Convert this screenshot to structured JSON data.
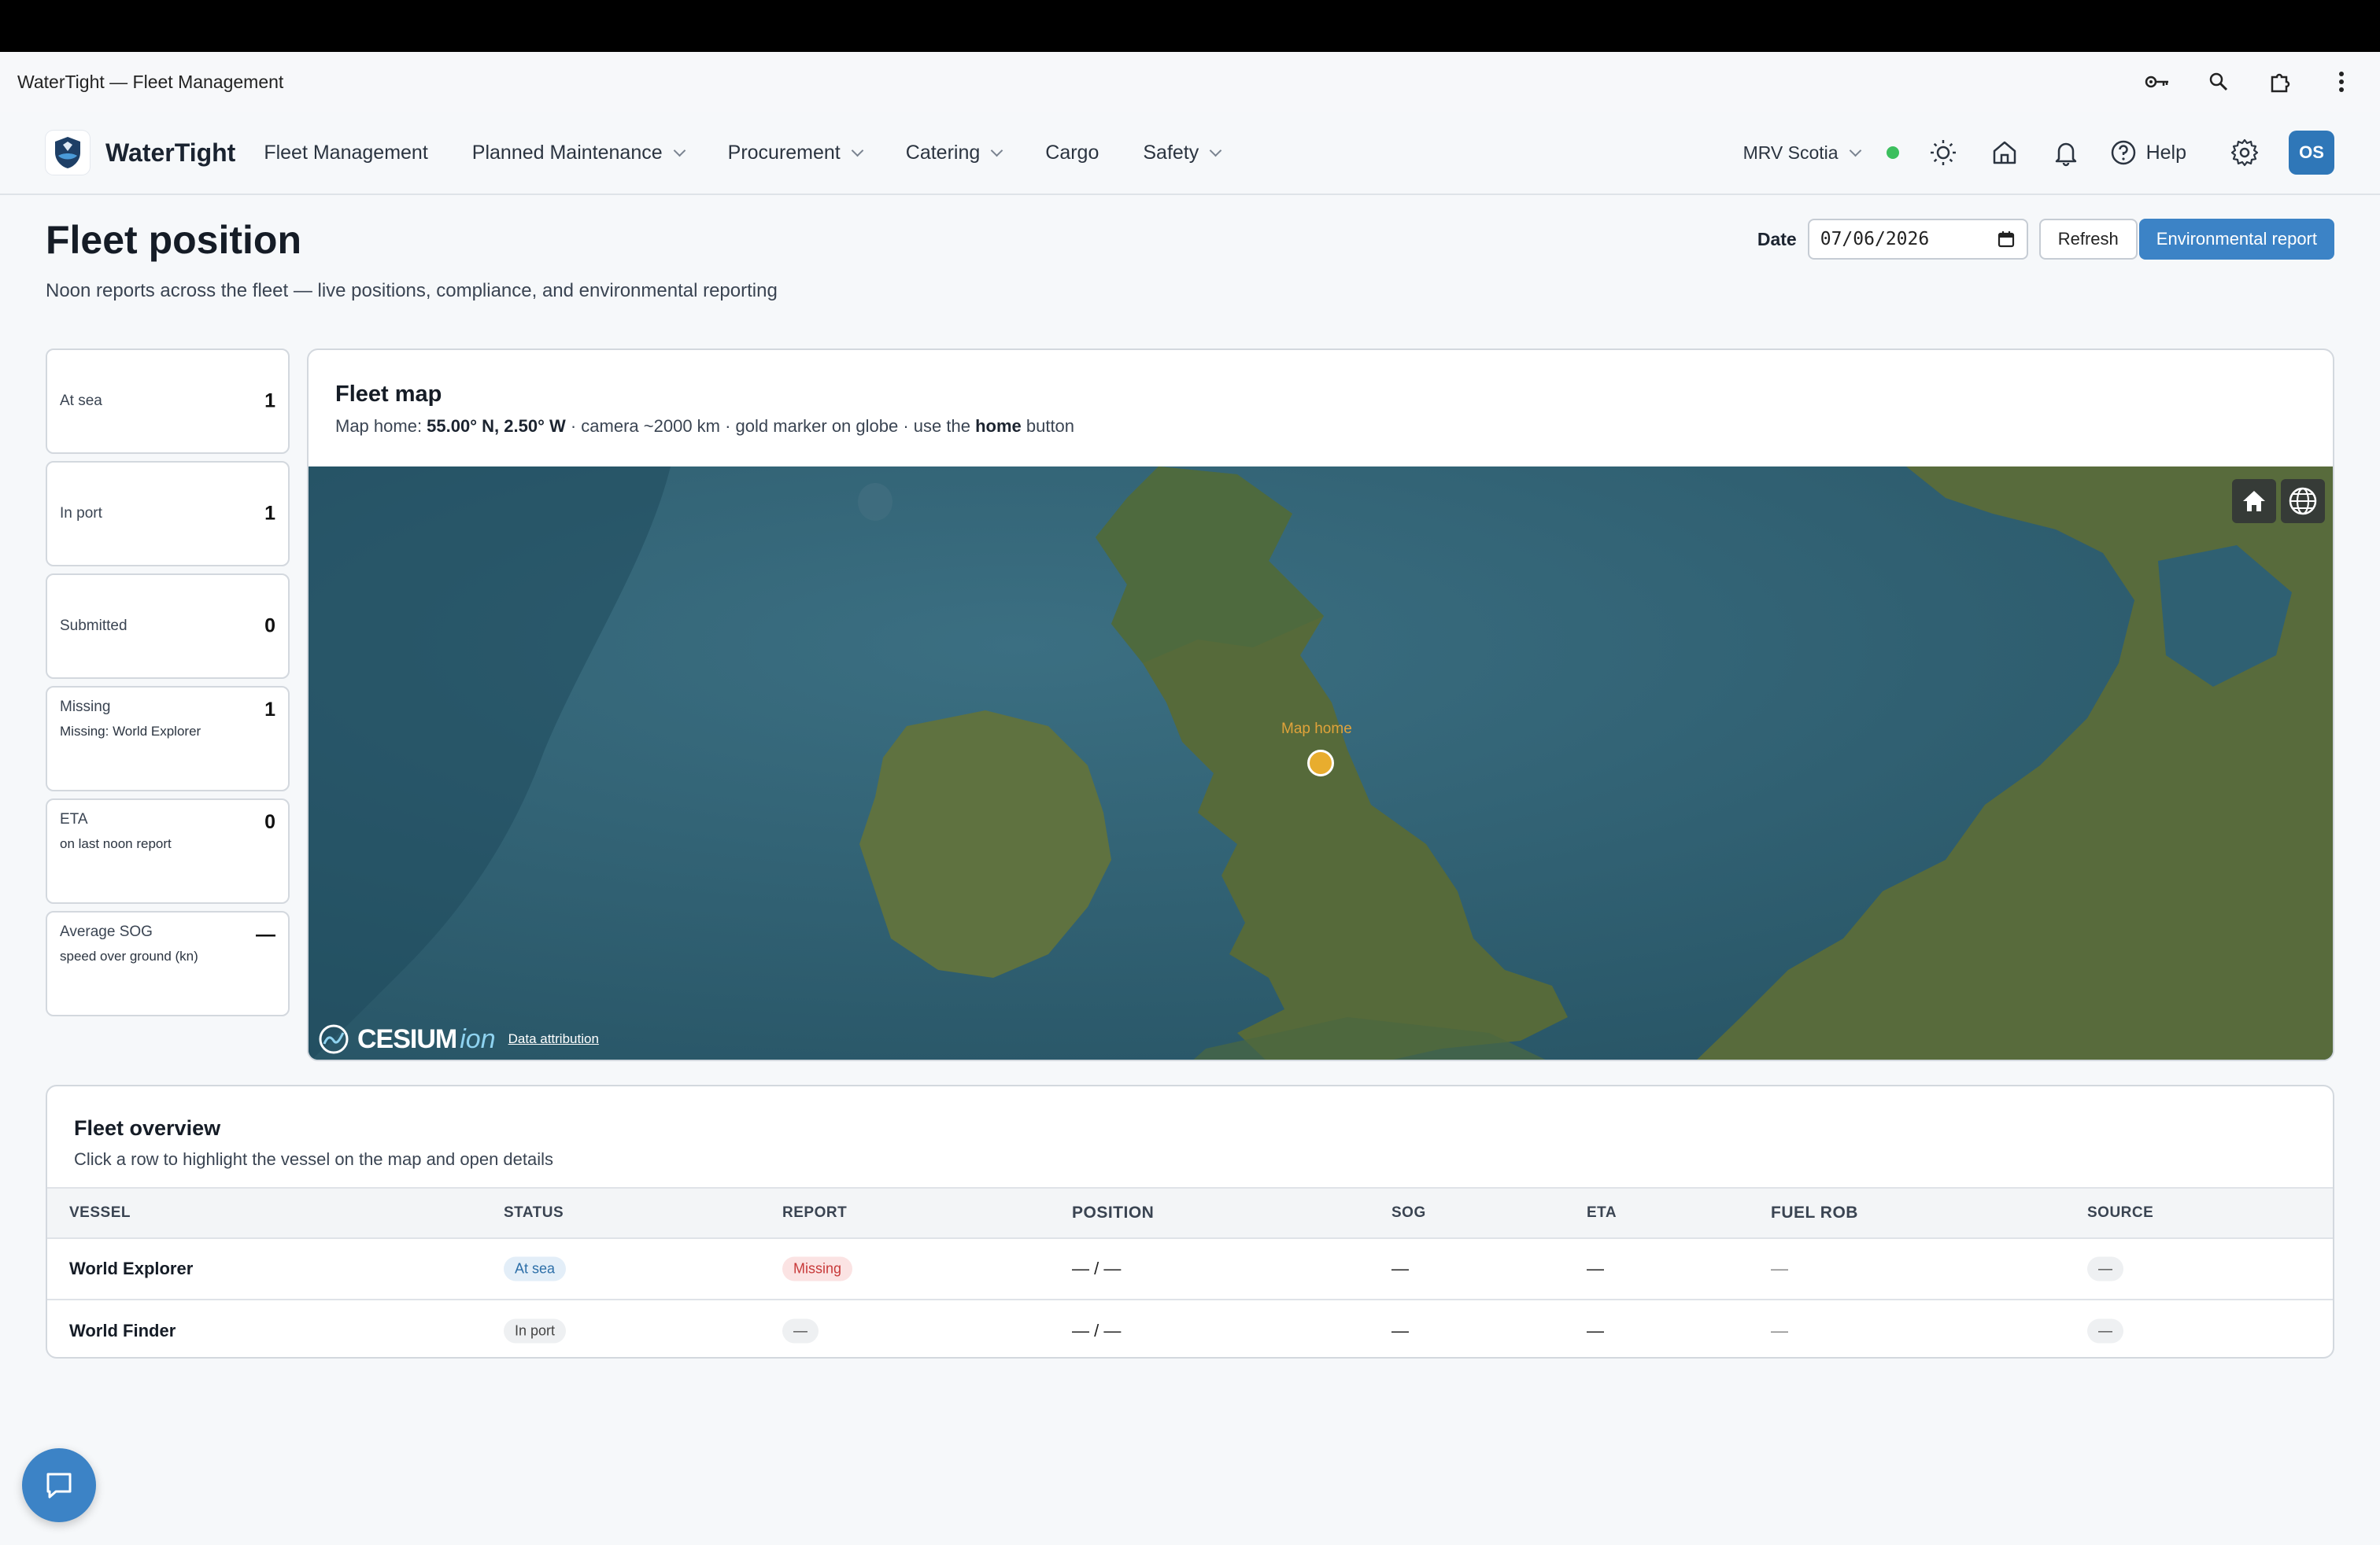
{
  "window": {
    "title": "WaterTight — Fleet Management"
  },
  "app": {
    "brand": "WaterTight",
    "nav": [
      {
        "label": "Fleet Management",
        "dropdown": false
      },
      {
        "label": "Planned Maintenance",
        "dropdown": true
      },
      {
        "label": "Procurement",
        "dropdown": true
      },
      {
        "label": "Catering",
        "dropdown": true
      },
      {
        "label": "Cargo",
        "dropdown": false
      },
      {
        "label": "Safety",
        "dropdown": true
      }
    ],
    "vessel_selector": "MRV Scotia",
    "help_label": "Help",
    "avatar_initials": "OS"
  },
  "page": {
    "title": "Fleet position",
    "subtitle": "Noon reports across the fleet — live positions, compliance, and environmental reporting",
    "date_label": "Date",
    "date_value": "07/06/2026",
    "refresh_label": "Refresh",
    "env_report_label": "Environmental report"
  },
  "stats": [
    {
      "label": "At sea",
      "value": "1",
      "sub": ""
    },
    {
      "label": "In port",
      "value": "1",
      "sub": ""
    },
    {
      "label": "Submitted",
      "value": "0",
      "sub": ""
    },
    {
      "label": "Missing",
      "value": "1",
      "sub": "Missing: World Explorer"
    },
    {
      "label": "ETA",
      "value": "0",
      "sub": "on last noon report"
    },
    {
      "label": "Average SOG",
      "value": "—",
      "sub": "speed over ground (kn)"
    }
  ],
  "map": {
    "title": "Fleet map",
    "desc_prefix": "Map home: ",
    "desc_coords": "55.00° N, 2.50° W",
    "desc_mid": " · camera ~2000 km · gold marker on globe · use the ",
    "desc_home": "home",
    "desc_suffix": " button",
    "marker_label": "Map home",
    "cesium_name": "CESIUM",
    "cesium_ion": "ion",
    "attribution": "Data attribution",
    "colors": {
      "water": "#2d5f72",
      "land": "#5a6b3c",
      "marker": "#e8ad2e"
    }
  },
  "table": {
    "title": "Fleet overview",
    "subtitle": "Click a row to highlight the vessel on the map and open details",
    "columns": [
      "VESSEL",
      "STATUS",
      "REPORT",
      "POSITION",
      "SOG",
      "ETA",
      "FUEL ROB",
      "SOURCE"
    ],
    "rows": [
      {
        "vessel": "World Explorer",
        "status": "At sea",
        "report": "Missing",
        "position": "— / —",
        "sog": "—",
        "eta": "—",
        "fuel_rob": "—",
        "source": "—"
      },
      {
        "vessel": "World Finder",
        "status": "In port",
        "report": "—",
        "position": "— / —",
        "sog": "—",
        "eta": "—",
        "fuel_rob": "—",
        "source": "—"
      }
    ]
  }
}
